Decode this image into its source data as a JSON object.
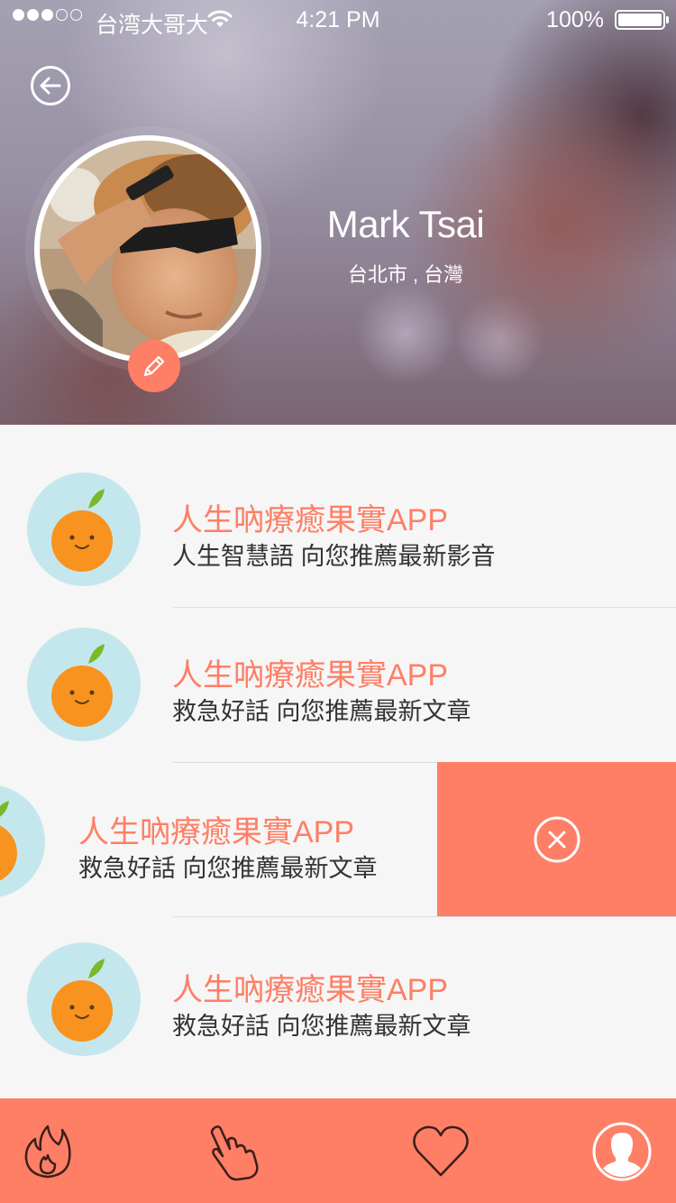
{
  "status_bar": {
    "carrier": "台湾大哥大",
    "time": "4:21 PM",
    "battery": "100%",
    "signal_bars_filled": 3,
    "signal_bars_total": 5
  },
  "profile": {
    "name": "Mark Tsai",
    "location": "台北市 , 台灣"
  },
  "list": {
    "items": [
      {
        "title": "人生吶療癒果實APP",
        "subtitle": "人生智慧語  向您推薦最新影音",
        "icon": "orange-fruit-icon"
      },
      {
        "title": "人生吶療癒果實APP",
        "subtitle": "救急好話  向您推薦最新文章",
        "icon": "orange-fruit-icon"
      },
      {
        "title": "人生吶療癒果實APP",
        "subtitle": "救急好話  向您推薦最新文章",
        "icon": "orange-fruit-icon",
        "swiped": true
      },
      {
        "title": "人生吶療癒果實APP",
        "subtitle": "救急好話  向您推薦最新文章",
        "icon": "orange-fruit-icon"
      }
    ]
  },
  "tabbar": {
    "tabs": [
      "flame-icon",
      "pointing-hand-icon",
      "heart-icon",
      "profile-icon"
    ],
    "active": "profile-icon"
  },
  "colors": {
    "accent": "#fe7f66",
    "icon_bg": "#c4e7ee",
    "orange": "#f7931e",
    "leaf": "#7ab929"
  }
}
